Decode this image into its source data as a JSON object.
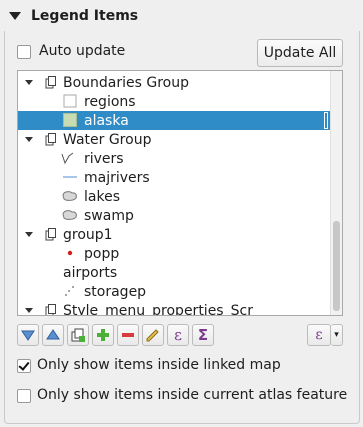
{
  "panel": {
    "title": "Legend Items",
    "auto_update_label": "Auto update",
    "auto_update_checked": false,
    "update_all_label": "Update All"
  },
  "tree": {
    "items": [
      {
        "label": "Boundaries Group",
        "type": "group",
        "level": 0,
        "expanded": true,
        "icon": "group-icon"
      },
      {
        "label": "regions",
        "type": "layer",
        "level": 1,
        "icon": "white-fill-symbol-icon"
      },
      {
        "label": "alaska",
        "type": "layer",
        "level": 1,
        "icon": "green-fill-symbol-icon",
        "selected": true
      },
      {
        "label": "Water Group",
        "type": "group",
        "level": 0,
        "expanded": true,
        "icon": "group-icon"
      },
      {
        "label": "rivers",
        "type": "layer",
        "level": 1,
        "icon": "line-vector-icon"
      },
      {
        "label": "majrivers",
        "type": "layer",
        "level": 1,
        "icon": "blue-line-symbol-icon"
      },
      {
        "label": "lakes",
        "type": "layer",
        "level": 1,
        "icon": "gray-polygon-symbol-icon"
      },
      {
        "label": "swamp",
        "type": "layer",
        "level": 1,
        "icon": "gray-polygon-symbol-icon"
      },
      {
        "label": "group1",
        "type": "group",
        "level": 0,
        "expanded": true,
        "icon": "group-icon"
      },
      {
        "label": "popp",
        "type": "layer",
        "level": 1,
        "icon": "red-point-symbol-icon"
      },
      {
        "label": "airports",
        "type": "layer",
        "level": 0,
        "icon": ""
      },
      {
        "label": "storagep",
        "type": "layer",
        "level": 1,
        "icon": "point-vector-icon"
      },
      {
        "label": "Style_menu_properties_Scr",
        "type": "group",
        "level": 0,
        "expanded": true,
        "icon": "group-icon"
      }
    ]
  },
  "toolbar": {
    "buttons": [
      "move-down-icon",
      "move-up-icon",
      "add-group-icon",
      "add-item-icon",
      "remove-item-icon",
      "edit-item-icon",
      "expression-icon",
      "sum-icon",
      "filter-expression-icon"
    ]
  },
  "options": {
    "linked_map_label": "Only show items inside linked map",
    "linked_map_checked": true,
    "atlas_label": "Only show items inside current atlas feature",
    "atlas_checked": false
  },
  "colors": {
    "selection": "#308cc6",
    "alaska_fill": "#c8dcb4",
    "river_line": "#6fa0d8",
    "popp_point": "#d21e1e"
  }
}
